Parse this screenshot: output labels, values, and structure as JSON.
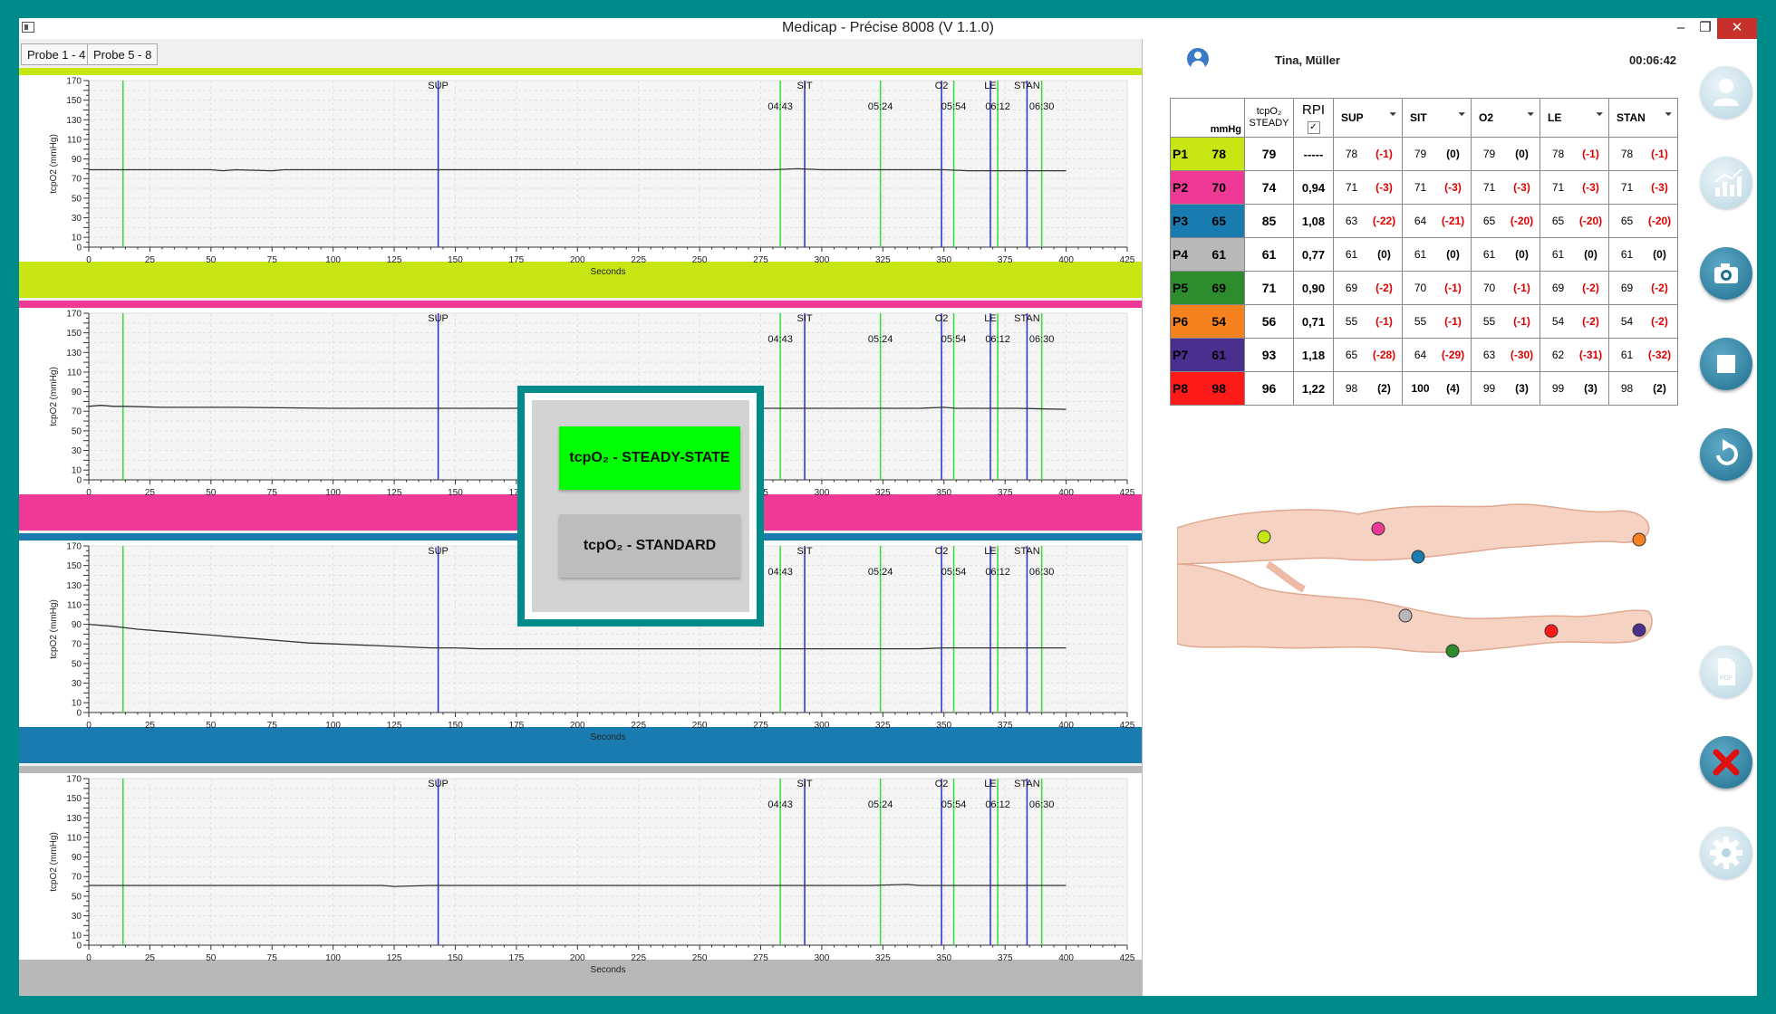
{
  "window": {
    "title": "Medicap - Précise 8008 (V 1.1.0)",
    "min_glyph": "–",
    "max_glyph": "❐",
    "close_glyph": "✕"
  },
  "tabs": [
    {
      "label": "Probe 1 - 4"
    },
    {
      "label": "Probe 5 - 8"
    }
  ],
  "chart_data": [
    {
      "type": "line",
      "ylabel": "tcpO2 (mmHg)",
      "xlabel": "Seconds",
      "xlim": [
        0,
        425
      ],
      "ylim": [
        0,
        170
      ],
      "grid": true,
      "band_color": "#c8e614",
      "xticks": [
        0,
        25,
        50,
        75,
        100,
        125,
        150,
        175,
        200,
        225,
        250,
        275,
        300,
        325,
        350,
        375,
        400,
        425
      ],
      "yticks": [
        0,
        10,
        30,
        50,
        70,
        90,
        110,
        130,
        150,
        170
      ],
      "events": [
        {
          "label": "SUP",
          "x": 143
        },
        {
          "label": "SIT",
          "x": 293
        },
        {
          "label": "O2",
          "x": 349
        },
        {
          "label": "LE",
          "x": 369
        },
        {
          "label": "STAN",
          "x": 384
        }
      ],
      "time_markers": [
        {
          "label": "04:43",
          "x": 283
        },
        {
          "label": "05:24",
          "x": 324
        },
        {
          "label": "05:54",
          "x": 354
        },
        {
          "label": "06:12",
          "x": 372
        },
        {
          "label": "06:30",
          "x": 390
        }
      ],
      "green_lines": [
        14,
        283,
        324,
        354,
        372,
        390
      ],
      "blue_lines": [
        143,
        293,
        349,
        369,
        384
      ],
      "series": [
        {
          "color": "#333333",
          "x": [
            0,
            50,
            55,
            60,
            75,
            80,
            100,
            140,
            180,
            200,
            280,
            290,
            300,
            340,
            350,
            360,
            400
          ],
          "y": [
            79,
            79,
            78,
            79,
            78,
            79,
            79,
            79,
            79,
            79,
            79,
            80,
            79,
            79,
            79,
            78,
            78
          ]
        }
      ]
    },
    {
      "type": "line",
      "ylabel": "tcpO2 (mmHg)",
      "xlabel": "Seconds",
      "xlim": [
        0,
        425
      ],
      "ylim": [
        0,
        170
      ],
      "grid": true,
      "band_color": "#ee3a96",
      "xticks": [
        0,
        25,
        50,
        75,
        100,
        125,
        150,
        175,
        200,
        225,
        250,
        275,
        300,
        325,
        350,
        375,
        400,
        425
      ],
      "yticks": [
        0,
        10,
        30,
        50,
        70,
        90,
        110,
        130,
        150,
        170
      ],
      "events": [
        {
          "label": "SUP",
          "x": 143
        },
        {
          "label": "SIT",
          "x": 293
        },
        {
          "label": "O2",
          "x": 349
        },
        {
          "label": "LE",
          "x": 369
        },
        {
          "label": "STAN",
          "x": 384
        }
      ],
      "time_markers": [
        {
          "label": "04:43",
          "x": 283
        },
        {
          "label": "05:24",
          "x": 324
        },
        {
          "label": "05:54",
          "x": 354
        },
        {
          "label": "06:12",
          "x": 372
        },
        {
          "label": "06:30",
          "x": 390
        }
      ],
      "green_lines": [
        14,
        283,
        324,
        354,
        372,
        390
      ],
      "blue_lines": [
        143,
        293,
        349,
        369,
        384
      ],
      "series": [
        {
          "color": "#333333",
          "x": [
            0,
            5,
            10,
            15,
            30,
            60,
            100,
            140,
            180,
            250,
            300,
            340,
            350,
            355,
            380,
            400
          ],
          "y": [
            75,
            76,
            75,
            75,
            74,
            74,
            73,
            73,
            73,
            73,
            73,
            73,
            74,
            73,
            73,
            72
          ]
        }
      ]
    },
    {
      "type": "line",
      "ylabel": "tcpO2 (mmHg)",
      "xlabel": "Seconds",
      "xlim": [
        0,
        425
      ],
      "ylim": [
        0,
        170
      ],
      "grid": true,
      "band_color": "#1a7bb0",
      "xticks": [
        0,
        25,
        50,
        75,
        100,
        125,
        150,
        175,
        200,
        225,
        250,
        275,
        300,
        325,
        350,
        375,
        400,
        425
      ],
      "yticks": [
        0,
        10,
        30,
        50,
        70,
        90,
        110,
        130,
        150,
        170
      ],
      "events": [
        {
          "label": "SUP",
          "x": 143
        },
        {
          "label": "SIT",
          "x": 293
        },
        {
          "label": "O2",
          "x": 349
        },
        {
          "label": "LE",
          "x": 369
        },
        {
          "label": "STAN",
          "x": 384
        }
      ],
      "time_markers": [
        {
          "label": "04:43",
          "x": 283
        },
        {
          "label": "05:24",
          "x": 324
        },
        {
          "label": "05:54",
          "x": 354
        },
        {
          "label": "06:12",
          "x": 372
        },
        {
          "label": "06:30",
          "x": 390
        }
      ],
      "green_lines": [
        14,
        283,
        324,
        354,
        372,
        390
      ],
      "blue_lines": [
        143,
        293,
        349,
        369,
        384
      ],
      "series": [
        {
          "color": "#333333",
          "x": [
            0,
            10,
            20,
            30,
            40,
            50,
            60,
            70,
            80,
            90,
            100,
            110,
            120,
            130,
            140,
            150,
            160,
            170,
            180,
            200,
            220,
            250,
            280,
            300,
            320,
            340,
            350,
            375,
            400
          ],
          "y": [
            90,
            88,
            85,
            83,
            81,
            79,
            77,
            75,
            73,
            71,
            70,
            69,
            68,
            67,
            66,
            66,
            65,
            65,
            65,
            65,
            65,
            65,
            65,
            65,
            65,
            65,
            66,
            66,
            66
          ]
        }
      ]
    },
    {
      "type": "line",
      "ylabel": "tcpO2 (mmHg)",
      "xlabel": "Seconds",
      "xlim": [
        0,
        425
      ],
      "ylim": [
        0,
        170
      ],
      "grid": true,
      "band_color": "#b8b8b8",
      "xticks": [
        0,
        25,
        50,
        75,
        100,
        125,
        150,
        175,
        200,
        225,
        250,
        275,
        300,
        325,
        350,
        375,
        400,
        425
      ],
      "yticks": [
        0,
        10,
        30,
        50,
        70,
        90,
        110,
        130,
        150,
        170
      ],
      "events": [
        {
          "label": "SUP",
          "x": 143
        },
        {
          "label": "SIT",
          "x": 293
        },
        {
          "label": "O2",
          "x": 349
        },
        {
          "label": "LE",
          "x": 369
        },
        {
          "label": "STAN",
          "x": 384
        }
      ],
      "time_markers": [
        {
          "label": "04:43",
          "x": 283
        },
        {
          "label": "05:24",
          "x": 324
        },
        {
          "label": "05:54",
          "x": 354
        },
        {
          "label": "06:12",
          "x": 372
        },
        {
          "label": "06:30",
          "x": 390
        }
      ],
      "green_lines": [
        14,
        283,
        324,
        354,
        372,
        390
      ],
      "blue_lines": [
        143,
        293,
        349,
        369,
        384
      ],
      "series": [
        {
          "color": "#333333",
          "x": [
            0,
            60,
            100,
            120,
            125,
            140,
            150,
            200,
            250,
            300,
            320,
            335,
            340,
            350,
            400
          ],
          "y": [
            61,
            61,
            61,
            61,
            60,
            61,
            61,
            61,
            61,
            61,
            61,
            62,
            61,
            61,
            61
          ]
        }
      ]
    }
  ],
  "patient": {
    "name": "Tina, Müller",
    "elapsed": "00:06:42"
  },
  "table": {
    "unit": "mmHg",
    "steady_line1": "tcpO₂",
    "steady_line2": "STEADY",
    "rpi_label": "RPI",
    "rpi_check": "✓",
    "columns": [
      "SUP",
      "SIT",
      "O2",
      "LE",
      "STAN"
    ],
    "caret": "⏷",
    "rows": [
      {
        "id": "P1",
        "color": "#c8e614",
        "value": "78",
        "steady": "79",
        "rpi": "-----",
        "cells": [
          [
            "78",
            "(-1)"
          ],
          [
            "79",
            "(0)"
          ],
          [
            "79",
            "(0)"
          ],
          [
            "78",
            "(-1)"
          ],
          [
            "78",
            "(-1)"
          ]
        ]
      },
      {
        "id": "P2",
        "color": "#ee3a96",
        "value": "70",
        "steady": "74",
        "rpi": "0,94",
        "cells": [
          [
            "71",
            "(-3)"
          ],
          [
            "71",
            "(-3)"
          ],
          [
            "71",
            "(-3)"
          ],
          [
            "71",
            "(-3)"
          ],
          [
            "71",
            "(-3)"
          ]
        ]
      },
      {
        "id": "P3",
        "color": "#1a7bb0",
        "value": "65",
        "steady": "85",
        "rpi": "1,08",
        "cells": [
          [
            "63",
            "(-22)"
          ],
          [
            "64",
            "(-21)"
          ],
          [
            "65",
            "(-20)"
          ],
          [
            "65",
            "(-20)"
          ],
          [
            "65",
            "(-20)"
          ]
        ]
      },
      {
        "id": "P4",
        "color": "#b8b8b8",
        "value": "61",
        "steady": "61",
        "rpi": "0,77",
        "cells": [
          [
            "61",
            "(0)"
          ],
          [
            "61",
            "(0)"
          ],
          [
            "61",
            "(0)"
          ],
          [
            "61",
            "(0)"
          ],
          [
            "61",
            "(0)"
          ]
        ]
      },
      {
        "id": "P5",
        "color": "#2e8b2e",
        "value": "69",
        "steady": "71",
        "rpi": "0,90",
        "cells": [
          [
            "69",
            "(-2)"
          ],
          [
            "70",
            "(-1)"
          ],
          [
            "70",
            "(-1)"
          ],
          [
            "69",
            "(-2)"
          ],
          [
            "69",
            "(-2)"
          ]
        ]
      },
      {
        "id": "P6",
        "color": "#f5821f",
        "value": "54",
        "steady": "56",
        "rpi": "0,71",
        "cells": [
          [
            "55",
            "(-1)"
          ],
          [
            "55",
            "(-1)"
          ],
          [
            "55",
            "(-1)"
          ],
          [
            "54",
            "(-2)"
          ],
          [
            "54",
            "(-2)"
          ]
        ]
      },
      {
        "id": "P7",
        "color": "#4b2f8f",
        "value": "61",
        "steady": "93",
        "rpi": "1,18",
        "cells": [
          [
            "65",
            "(-28)"
          ],
          [
            "64",
            "(-29)"
          ],
          [
            "63",
            "(-30)"
          ],
          [
            "62",
            "(-31)"
          ],
          [
            "61",
            "(-32)"
          ]
        ]
      },
      {
        "id": "P8",
        "color": "#ff1a1a",
        "value": "98",
        "steady": "96",
        "rpi": "1,22",
        "cells": [
          [
            "98",
            "(2)"
          ],
          [
            "100",
            "(4)"
          ],
          [
            "99",
            "(3)"
          ],
          [
            "99",
            "(3)"
          ],
          [
            "98",
            "(2)"
          ]
        ]
      }
    ]
  },
  "legs": {
    "probe_colors": [
      "#c8e614",
      "#ee3a96",
      "#1a7bb0",
      "#b8b8b8",
      "#2e8b2e",
      "#f5821f",
      "#4b2f8f",
      "#ff1a1a"
    ]
  },
  "dialog": {
    "steady_label": "tcpO₂ - STEADY-STATE",
    "standard_label": "tcpO₂ - STANDARD",
    "steady_color": "#00ff00"
  },
  "toolbar": {
    "icons": [
      "user-icon",
      "chart-icon",
      "camera-icon",
      "stop-icon",
      "refresh-icon",
      "pdf-icon",
      "close-icon",
      "gear-icon"
    ],
    "pdf_text": "PDF"
  }
}
